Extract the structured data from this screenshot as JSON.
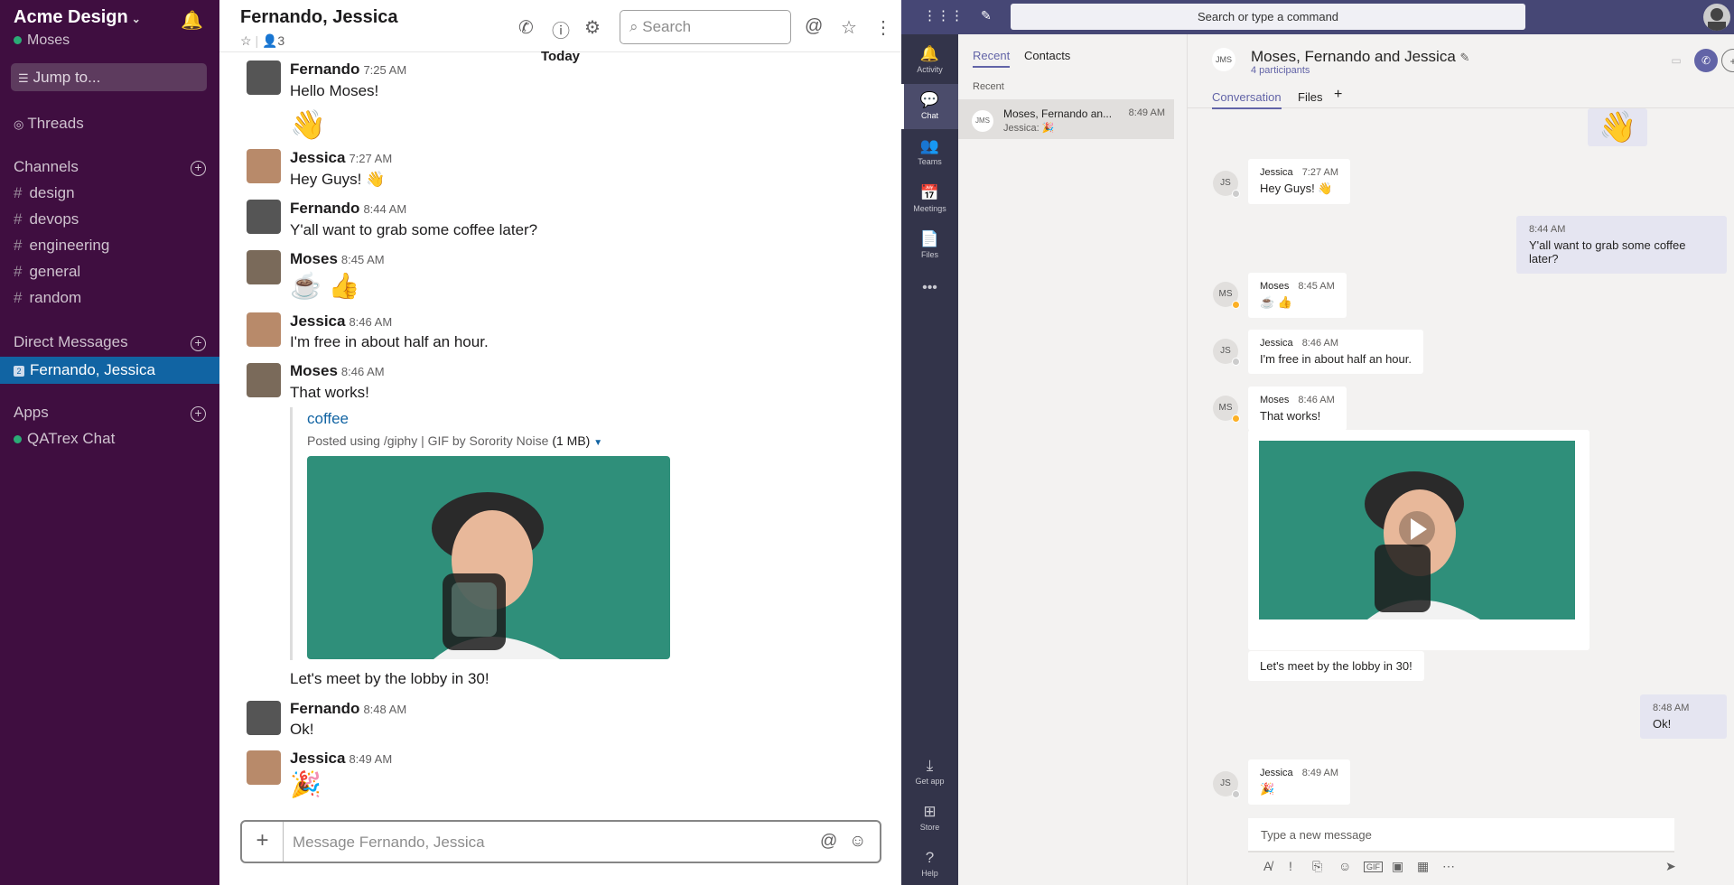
{
  "slack": {
    "workspace": "Acme Design",
    "user": "Moses",
    "jump": "Jump to...",
    "threads": "Threads",
    "channels_header": "Channels",
    "channels": [
      "design",
      "devops",
      "engineering",
      "general",
      "random"
    ],
    "dm_header": "Direct Messages",
    "dm_active": "Fernando, Jessica",
    "dm_badge": "2",
    "apps_header": "Apps",
    "app": "QATrex Chat",
    "channel_title": "Fernando, Jessica",
    "member_count": "3",
    "search_placeholder": "Search",
    "day_divider": "Today",
    "messages": [
      {
        "name": "Fernando",
        "time": "7:25 AM",
        "text": "Hello Moses!"
      },
      {
        "name": "",
        "time": "",
        "text": "👋"
      },
      {
        "name": "Jessica",
        "time": "7:27 AM",
        "text": "Hey Guys! 👋"
      },
      {
        "name": "Fernando",
        "time": "8:44 AM",
        "text": "Y'all want to grab some coffee later?"
      },
      {
        "name": "Moses",
        "time": "8:45 AM",
        "text": "☕ 👍"
      },
      {
        "name": "Jessica",
        "time": "8:46 AM",
        "text": "I'm free in about half an hour."
      },
      {
        "name": "Moses",
        "time": "8:46 AM",
        "text": "That works!"
      },
      {
        "name": "",
        "time": "",
        "text": "Let's meet by the lobby in 30!"
      },
      {
        "name": "Fernando",
        "time": "8:48 AM",
        "text": "Ok!"
      },
      {
        "name": "Jessica",
        "time": "8:49 AM",
        "text": "🎉"
      }
    ],
    "attachment": {
      "title": "coffee",
      "meta": "Posted using /giphy | GIF by Sorority Noise",
      "size": "(1 MB)"
    },
    "composer_placeholder": "Message Fernando, Jessica"
  },
  "teams": {
    "search": "Search or type a command",
    "rail": [
      "Activity",
      "Chat",
      "Teams",
      "Meetings",
      "Files",
      "Get app",
      "Store",
      "Help"
    ],
    "tabs": [
      "Recent",
      "Contacts"
    ],
    "recent_label": "Recent",
    "chat_item": {
      "name": "Moses, Fernando an...",
      "time": "8:49 AM",
      "preview": "Jessica: 🎉"
    },
    "conv_title": "Moses, Fernando and Jessica",
    "participants": "4 participants",
    "conv_tabs": [
      "Conversation",
      "Files"
    ],
    "messages": [
      {
        "initials": "JS",
        "name": "Jessica",
        "time": "7:27 AM",
        "text": "Hey Guys! 👋"
      },
      {
        "time": "8:44 AM",
        "text": "Y'all want to grab some coffee later?"
      },
      {
        "initials": "MS",
        "name": "Moses",
        "time": "8:45 AM",
        "text": "☕ 👍"
      },
      {
        "initials": "JS",
        "name": "Jessica",
        "time": "8:46 AM",
        "text": "I'm free in about half an hour."
      },
      {
        "initials": "MS",
        "name": "Moses",
        "time": "8:46 AM",
        "text": "That works!"
      },
      {
        "text": "Let's meet by the lobby in 30!"
      },
      {
        "time": "8:48 AM",
        "text": "Ok!"
      },
      {
        "initials": "JS",
        "name": "Jessica",
        "time": "8:49 AM",
        "text": "🎉"
      }
    ],
    "input_placeholder": "Type a new message",
    "wave": "👋"
  },
  "colors": {
    "slack_sidebar": "#3f0e40",
    "slack_active": "#1164a3",
    "teams_brand": "#464775",
    "teams_accent": "#6264a7"
  }
}
